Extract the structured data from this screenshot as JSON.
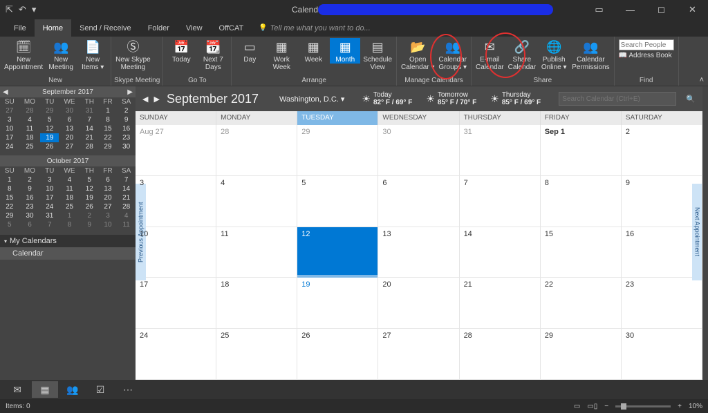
{
  "title": "Calendar",
  "titlebar": {
    "popout": "⇱",
    "undo": "↶",
    "down": "▾",
    "ribopt": "▭",
    "min": "—",
    "max": "◻",
    "close": "✕"
  },
  "tabs": [
    "File",
    "Home",
    "Send / Receive",
    "Folder",
    "View",
    "OffCAT"
  ],
  "tellme": "Tell me what you want to do...",
  "ribbon": {
    "new": {
      "label": "New",
      "items": [
        {
          "icon": "🗓",
          "label": "New\nAppointment"
        },
        {
          "icon": "👥",
          "label": "New\nMeeting"
        },
        {
          "icon": "📄",
          "label": "New\nItems ▾"
        }
      ]
    },
    "skype": {
      "label": "Skype Meeting",
      "items": [
        {
          "icon": "Ⓢ",
          "label": "New Skype\nMeeting"
        }
      ]
    },
    "goto": {
      "label": "Go To",
      "items": [
        {
          "icon": "📅",
          "label": "Today"
        },
        {
          "icon": "📆",
          "label": "Next 7\nDays"
        }
      ]
    },
    "arrange": {
      "label": "Arrange",
      "items": [
        {
          "icon": "▭",
          "label": "Day"
        },
        {
          "icon": "▦",
          "label": "Work\nWeek"
        },
        {
          "icon": "▦",
          "label": "Week"
        },
        {
          "icon": "▦",
          "label": "Month",
          "sel": true
        },
        {
          "icon": "▤",
          "label": "Schedule\nView"
        }
      ]
    },
    "manage": {
      "label": "Manage Calendars",
      "items": [
        {
          "icon": "📂",
          "label": "Open\nCalendar ▾"
        },
        {
          "icon": "👥",
          "label": "Calendar\nGroups ▾"
        }
      ]
    },
    "share": {
      "label": "Share",
      "items": [
        {
          "icon": "✉",
          "label": "E-mail\nCalendar"
        },
        {
          "icon": "🔗",
          "label": "Share\nCalendar"
        },
        {
          "icon": "🌐",
          "label": "Publish\nOnline ▾"
        },
        {
          "icon": "👥",
          "label": "Calendar\nPermissions"
        }
      ]
    },
    "find": {
      "label": "Find",
      "search_ph": "Search People",
      "ab": "Address Book"
    }
  },
  "mini": {
    "sep": {
      "title": "September 2017",
      "dow": [
        "SU",
        "MO",
        "TU",
        "WE",
        "TH",
        "FR",
        "SA"
      ],
      "rows": [
        [
          "27",
          "28",
          "29",
          "30",
          "31",
          "1",
          "2"
        ],
        [
          "3",
          "4",
          "5",
          "6",
          "7",
          "8",
          "9"
        ],
        [
          "10",
          "11",
          "12",
          "13",
          "14",
          "15",
          "16"
        ],
        [
          "17",
          "18",
          "19",
          "20",
          "21",
          "22",
          "23"
        ],
        [
          "24",
          "25",
          "26",
          "27",
          "28",
          "29",
          "30"
        ]
      ],
      "dimFirst": 5,
      "today": [
        3,
        2
      ]
    },
    "oct": {
      "title": "October 2017",
      "dow": [
        "SU",
        "MO",
        "TU",
        "WE",
        "TH",
        "FR",
        "SA"
      ],
      "rows": [
        [
          "1",
          "2",
          "3",
          "4",
          "5",
          "6",
          "7"
        ],
        [
          "8",
          "9",
          "10",
          "11",
          "12",
          "13",
          "14"
        ],
        [
          "15",
          "16",
          "17",
          "18",
          "19",
          "20",
          "21"
        ],
        [
          "22",
          "23",
          "24",
          "25",
          "26",
          "27",
          "28"
        ],
        [
          "29",
          "30",
          "31",
          "1",
          "2",
          "3",
          "4"
        ],
        [
          "5",
          "6",
          "7",
          "8",
          "9",
          "10",
          "11"
        ]
      ],
      "dimTailStart": [
        4,
        3
      ]
    }
  },
  "mycal": {
    "header": "My Calendars",
    "item": "Calendar"
  },
  "main": {
    "title": "September 2017",
    "location": "Washington,  D.C.  ▾",
    "weather": [
      {
        "day": "Today",
        "temp": "82° F / 69° F"
      },
      {
        "day": "Tomorrow",
        "temp": "85° F / 70° F"
      },
      {
        "day": "Thursday",
        "temp": "85° F / 69° F"
      }
    ],
    "search_ph": "Search Calendar (Ctrl+E)",
    "dow": [
      "SUNDAY",
      "MONDAY",
      "TUESDAY",
      "WEDNESDAY",
      "THURSDAY",
      "FRIDAY",
      "SATURDAY"
    ],
    "weeks": [
      [
        {
          "t": "Aug 27",
          "dim": true
        },
        {
          "t": "28",
          "dim": true
        },
        {
          "t": "29",
          "dim": true
        },
        {
          "t": "30",
          "dim": true
        },
        {
          "t": "31",
          "dim": true
        },
        {
          "t": "Sep 1",
          "bold": true
        },
        {
          "t": "2"
        }
      ],
      [
        {
          "t": "3"
        },
        {
          "t": "4"
        },
        {
          "t": "5"
        },
        {
          "t": "6"
        },
        {
          "t": "7"
        },
        {
          "t": "8"
        },
        {
          "t": "9"
        }
      ],
      [
        {
          "t": "10"
        },
        {
          "t": "11"
        },
        {
          "t": "12",
          "sel": true
        },
        {
          "t": "13"
        },
        {
          "t": "14"
        },
        {
          "t": "15"
        },
        {
          "t": "16"
        }
      ],
      [
        {
          "t": "17"
        },
        {
          "t": "18"
        },
        {
          "t": "19",
          "today": true
        },
        {
          "t": "20"
        },
        {
          "t": "21"
        },
        {
          "t": "22"
        },
        {
          "t": "23"
        }
      ],
      [
        {
          "t": "24"
        },
        {
          "t": "25"
        },
        {
          "t": "26"
        },
        {
          "t": "27"
        },
        {
          "t": "28"
        },
        {
          "t": "29"
        },
        {
          "t": "30"
        }
      ]
    ],
    "prevAppt": "Previous Appointment",
    "nextAppt": "Next Appointment"
  },
  "nav": {
    "mail": "✉",
    "cal": "▦",
    "people": "👥",
    "tasks": "☑",
    "more": "⋯"
  },
  "status": {
    "items": "Items: 0",
    "zoom": "10%"
  }
}
